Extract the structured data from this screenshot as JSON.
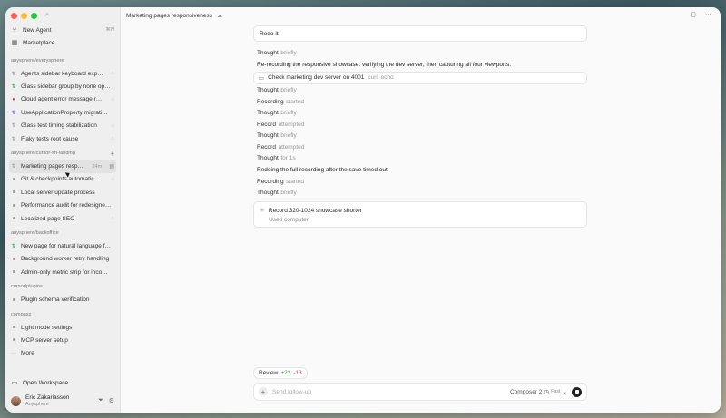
{
  "window": {
    "title": "Marketing pages responsiveness"
  },
  "sidebar": {
    "new_agent": "New Agent",
    "new_agent_shortcut": "⌘N",
    "marketplace": "Marketplace",
    "groups": [
      {
        "name": "anysphere/everysphere",
        "items": [
          {
            "label": "Agents sidebar keyboard expe…"
          },
          {
            "label": "Glass sidebar group by none op…"
          },
          {
            "label": "Cloud agent error message re…"
          },
          {
            "label": "UseApplicationProperty migrati…"
          },
          {
            "label": "Glass test timing stabilization"
          },
          {
            "label": "Flaky tests root cause"
          }
        ]
      },
      {
        "name": "anysphere/cursor-sh-landing",
        "items": [
          {
            "label": "Marketing pages respon…",
            "time": "24m",
            "active": true
          },
          {
            "label": "Git & checkpoints automatic c…"
          },
          {
            "label": "Local server update process"
          },
          {
            "label": "Performance audit for redesigne…"
          },
          {
            "label": "Localized page SEO"
          }
        ]
      },
      {
        "name": "anysphere/backoffice",
        "items": [
          {
            "label": "New page for natural language f…"
          },
          {
            "label": "Background worker retry handling"
          },
          {
            "label": "Admin-only metric strip for inco…"
          }
        ]
      },
      {
        "name": "cursor/plugins",
        "items": [
          {
            "label": "Plugin schema verification"
          }
        ]
      },
      {
        "name": "compass",
        "items": [
          {
            "label": "Light mode settings"
          },
          {
            "label": "MCP server setup"
          }
        ]
      }
    ],
    "more": "More",
    "open_workspace": "Open Workspace",
    "user": {
      "name": "Eric Zakariasson",
      "org": "Anysphere"
    }
  },
  "chat": {
    "user_message": "Redo it",
    "entries": [
      {
        "kind": "Thought",
        "detail": "briefly"
      },
      {
        "kind": "msg",
        "text": "Re-recording the responsive showcase: verifying the dev server, then capturing all four viewports."
      },
      {
        "kind": "tool",
        "text": "Check marketing dev server on 4001",
        "detail": "curl, echo"
      },
      {
        "kind": "Thought",
        "detail": "briefly"
      },
      {
        "kind": "Recording",
        "detail": "started"
      },
      {
        "kind": "Thought",
        "detail": "briefly"
      },
      {
        "kind": "Record",
        "detail": "attempted"
      },
      {
        "kind": "Thought",
        "detail": "briefly"
      },
      {
        "kind": "Record",
        "detail": "attempted"
      },
      {
        "kind": "Thought",
        "detail": "for 1s"
      },
      {
        "kind": "msg",
        "text": "Redoing the full recording after the save timed out."
      },
      {
        "kind": "Recording",
        "detail": "started"
      },
      {
        "kind": "Thought",
        "detail": "briefly"
      }
    ],
    "card": {
      "title": "Record 320-1024 showcase shorter",
      "subtitle": "Used computer"
    }
  },
  "review": {
    "label": "Review",
    "added": "+22",
    "removed": "-13"
  },
  "composer": {
    "placeholder": "Send follow-up",
    "model": "Composer 2",
    "speed": "Fast"
  }
}
